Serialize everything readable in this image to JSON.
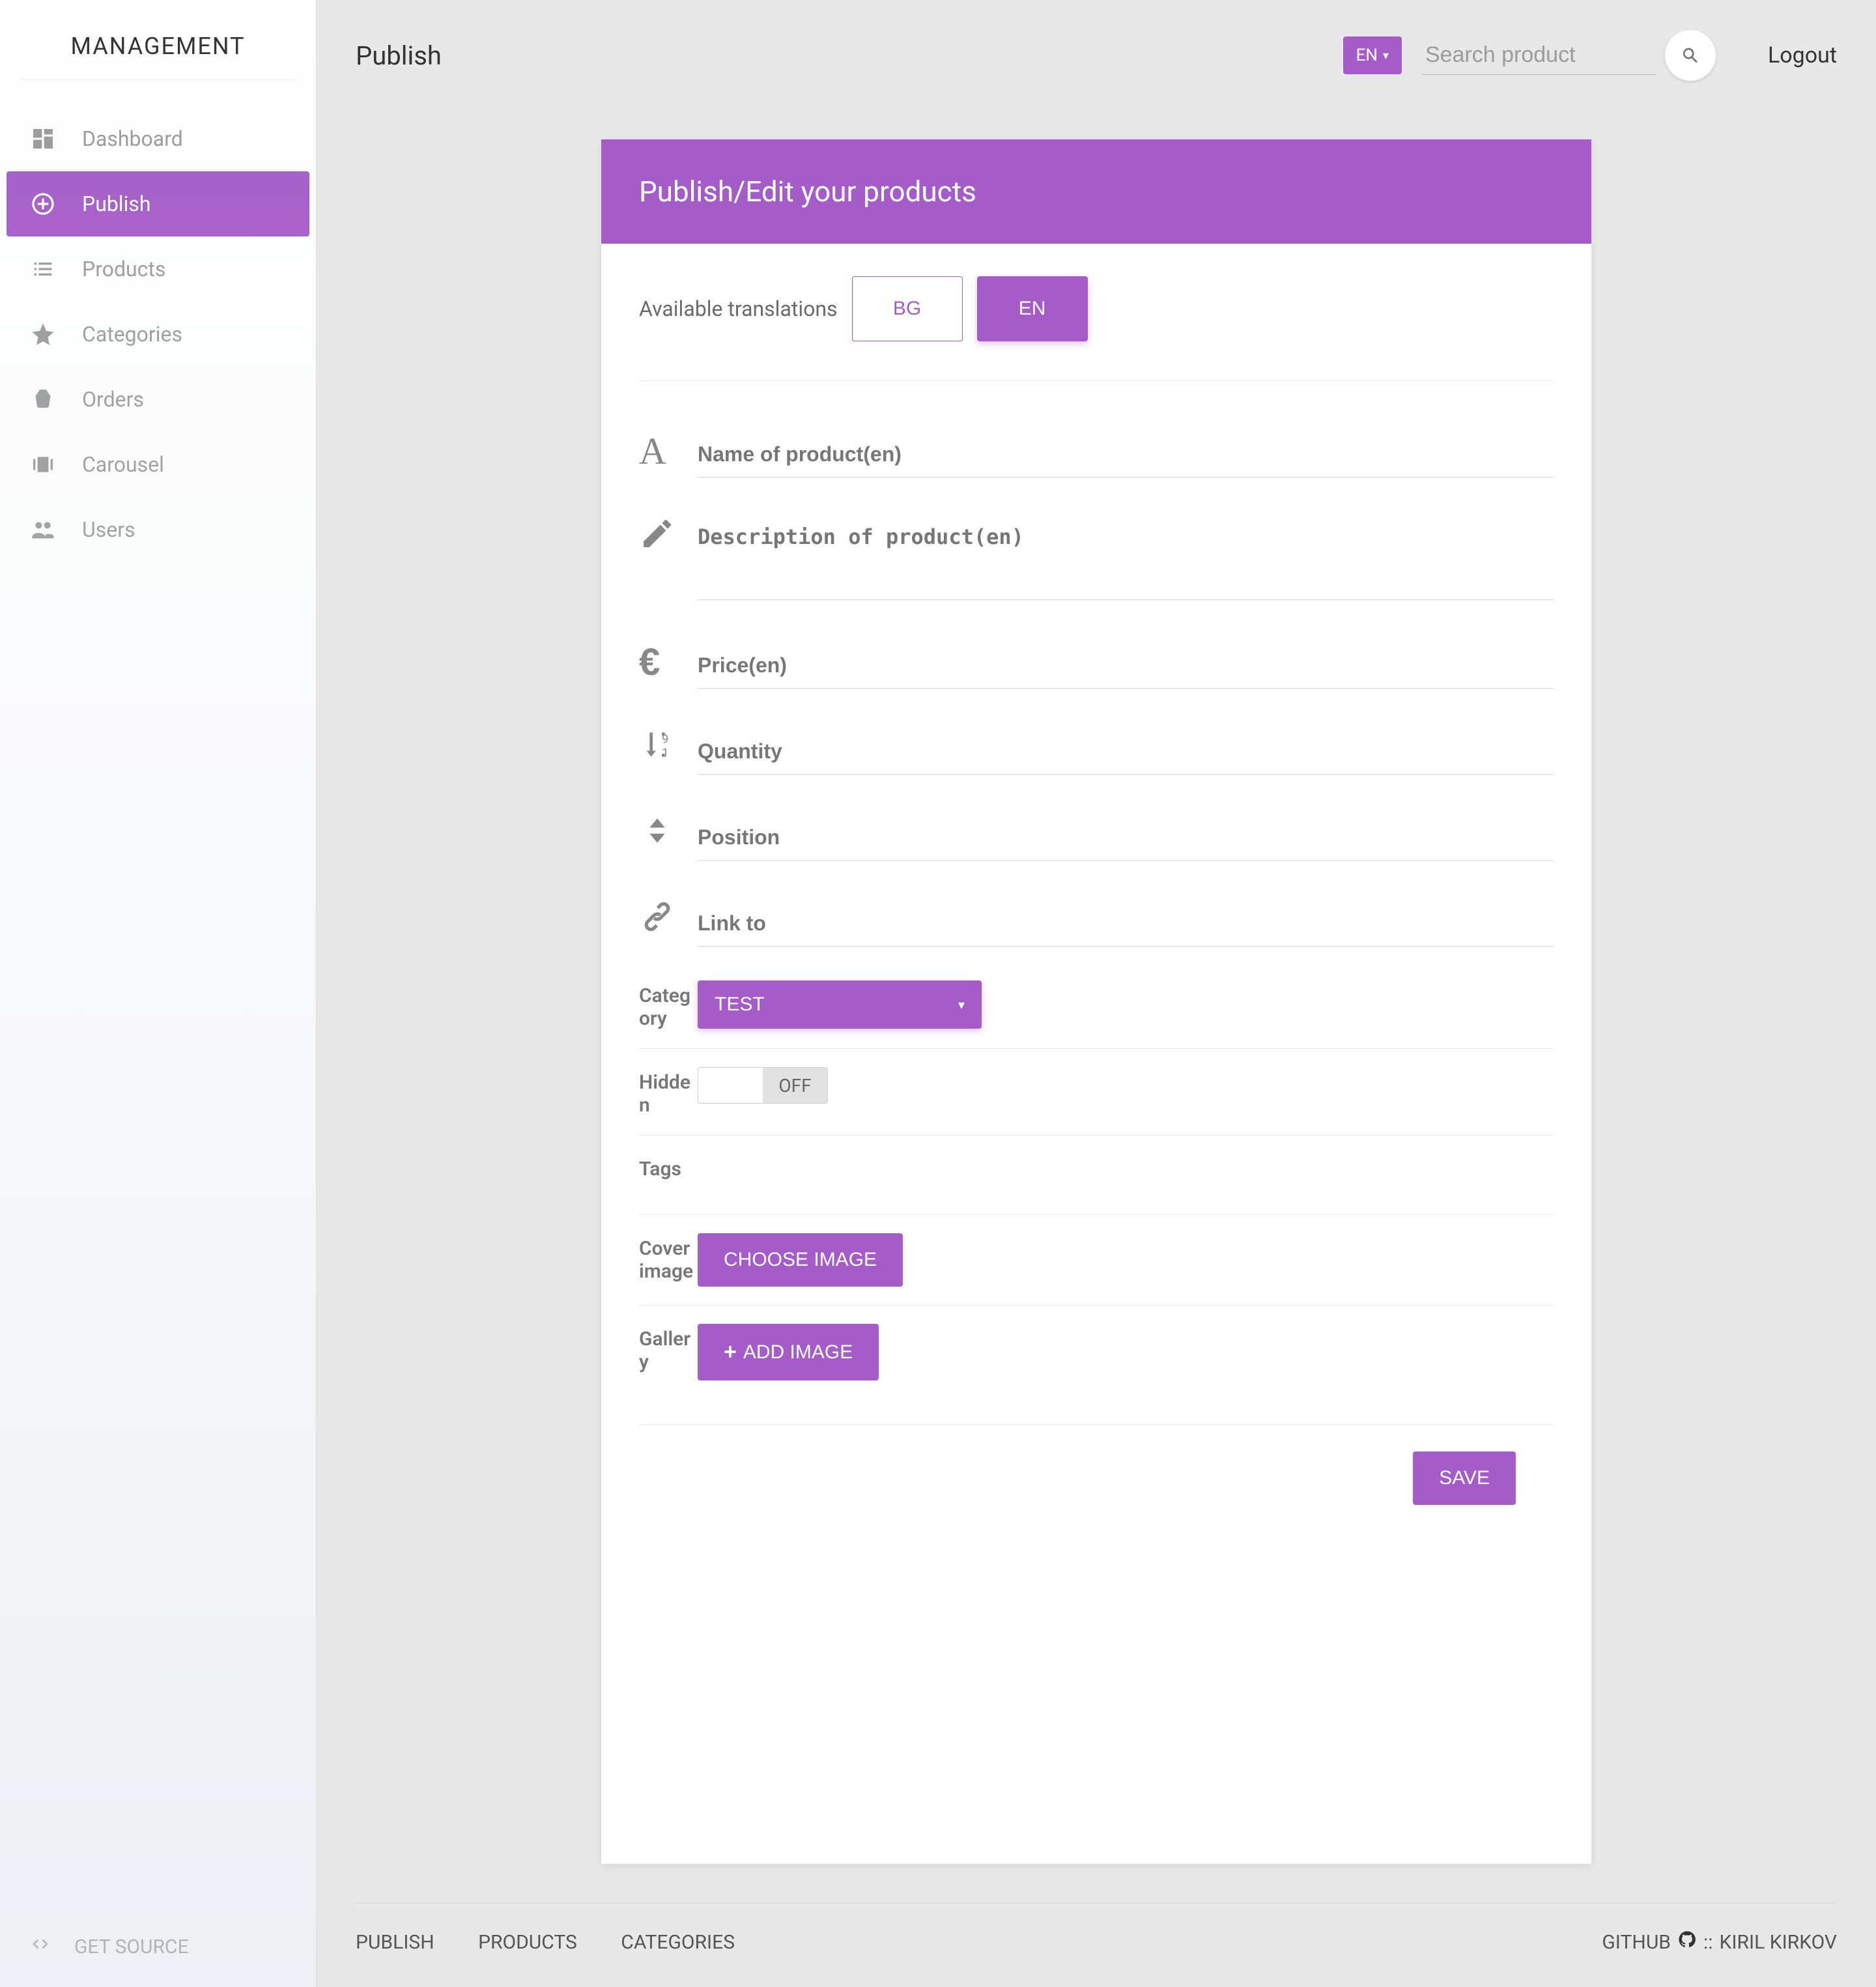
{
  "brand": "MANAGEMENT",
  "sidebar": {
    "items": [
      {
        "label": "Dashboard",
        "icon": "dashboard"
      },
      {
        "label": "Publish",
        "icon": "add-circle",
        "active": true
      },
      {
        "label": "Products",
        "icon": "list"
      },
      {
        "label": "Categories",
        "icon": "star"
      },
      {
        "label": "Orders",
        "icon": "basket"
      },
      {
        "label": "Carousel",
        "icon": "carousel"
      },
      {
        "label": "Users",
        "icon": "users"
      }
    ],
    "footer": {
      "label": "GET SOURCE"
    }
  },
  "header": {
    "title": "Publish",
    "lang": "EN",
    "search_placeholder": "Search product",
    "logout": "Logout"
  },
  "card": {
    "title": "Publish/Edit your products",
    "translations_label": "Available translations",
    "translations": [
      "BG",
      "EN"
    ],
    "active_translation": "EN",
    "fields": {
      "name_placeholder": "Name of product(en)",
      "description_placeholder": "Description of product(en)",
      "price_placeholder": "Price(en)",
      "quantity_placeholder": "Quantity",
      "position_placeholder": "Position",
      "linkto_placeholder": "Link to"
    },
    "category_label": "Category",
    "category_value": "TEST",
    "hidden_label": "Hidden",
    "hidden_value": "OFF",
    "tags_label": "Tags",
    "cover_label": "Cover image",
    "cover_button": "CHOOSE IMAGE",
    "gallery_label": "Gallery",
    "gallery_button": "ADD IMAGE",
    "save_button": "SAVE"
  },
  "footer": {
    "links": [
      "PUBLISH",
      "PRODUCTS",
      "CATEGORIES"
    ],
    "right_prefix": "GITHUB",
    "right_sep": "::",
    "right_author": "KIRIL KIRKOV"
  }
}
